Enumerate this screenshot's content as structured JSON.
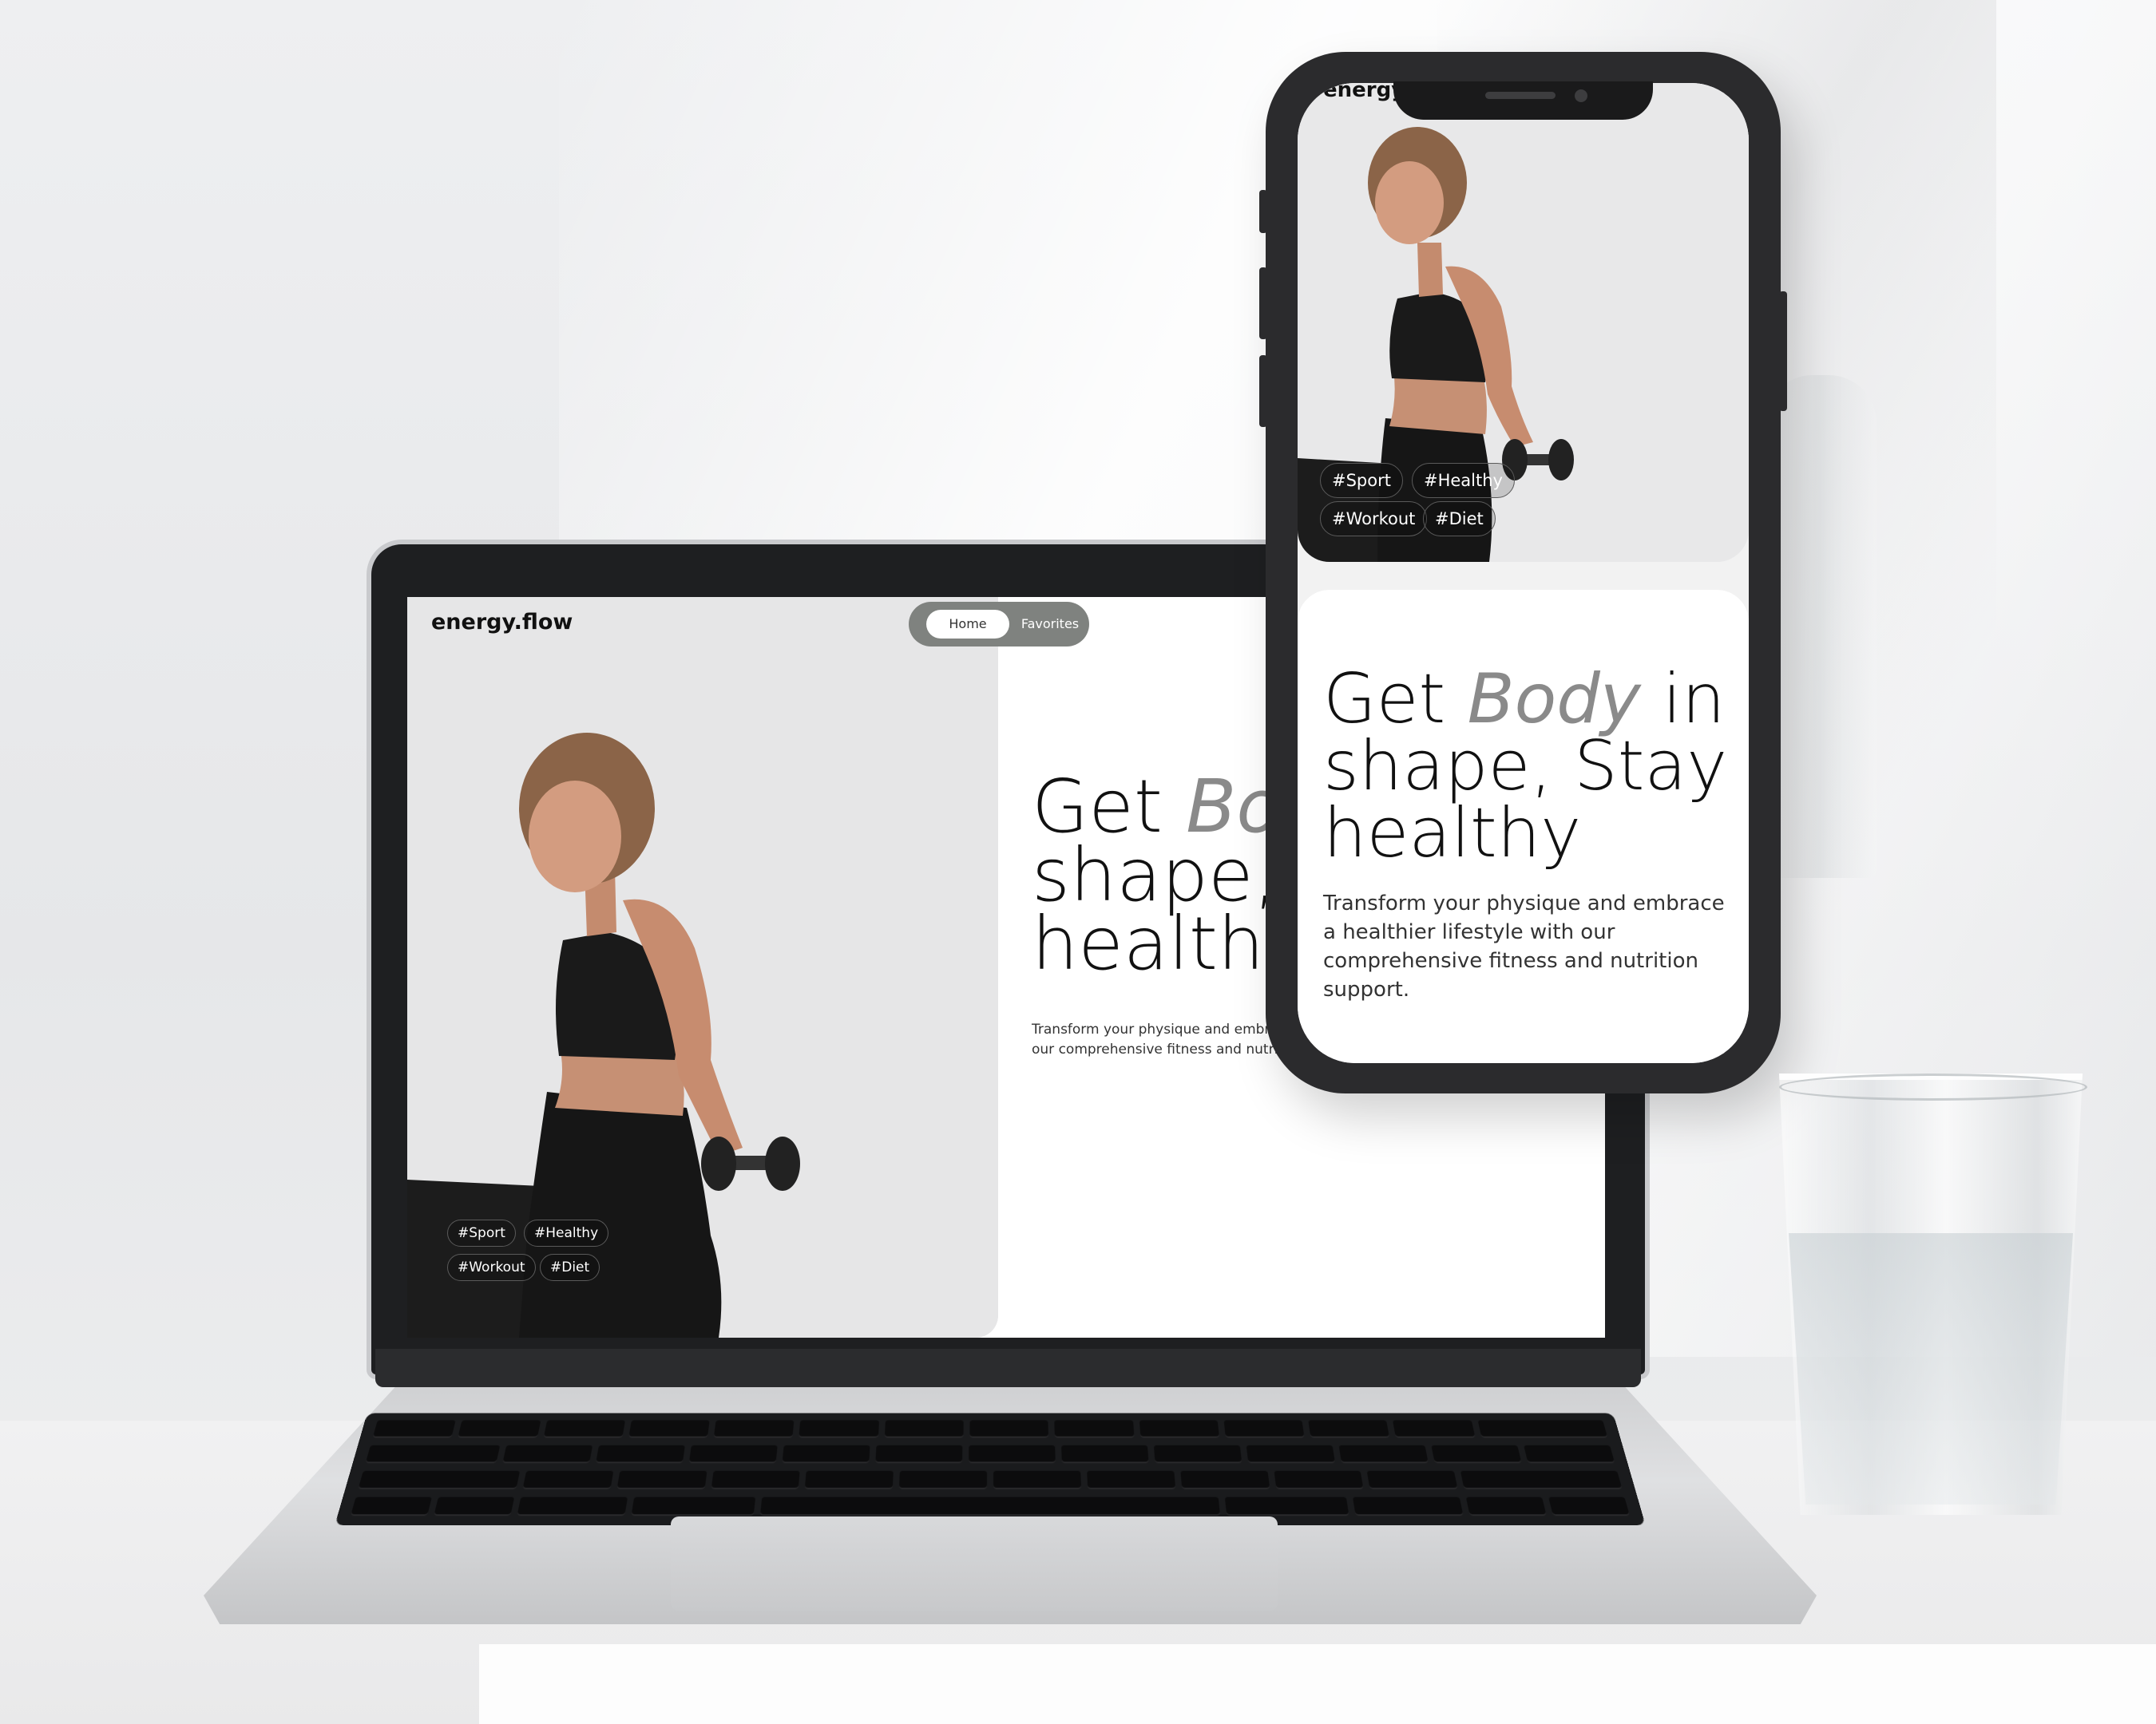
{
  "desktop": {
    "logo": "energy.flow",
    "nav": {
      "home": "Home",
      "favorites": "Favorites"
    },
    "hero": {
      "title_line1_start": "Get ",
      "title_emph": "Bo",
      "title_line2": "shape,",
      "title_line3": "healthy",
      "subtitle_line1": "Transform your physique and embr",
      "subtitle_line2": "our comprehensive fitness and nutri"
    },
    "tags": [
      "#Sport",
      "#Healthy",
      "#Workout",
      "#Diet"
    ]
  },
  "mobile": {
    "logo": "energy.",
    "tags": [
      "#Sport",
      "#Healthy",
      "#Workout",
      "#Diet"
    ],
    "hero": {
      "title_start": "Get ",
      "title_emph": "Body",
      "title_end": " in shape, Stay healthy",
      "subtitle": "Transform your physique and embrace a healthier lifestyle with our comprehensive fitness and nutrition support."
    }
  },
  "colors": {
    "nav_bg": "#7f827f",
    "hero_bg": "#e6e6e7",
    "title_emphasis": "#8a8a8a",
    "text": "#111111"
  }
}
